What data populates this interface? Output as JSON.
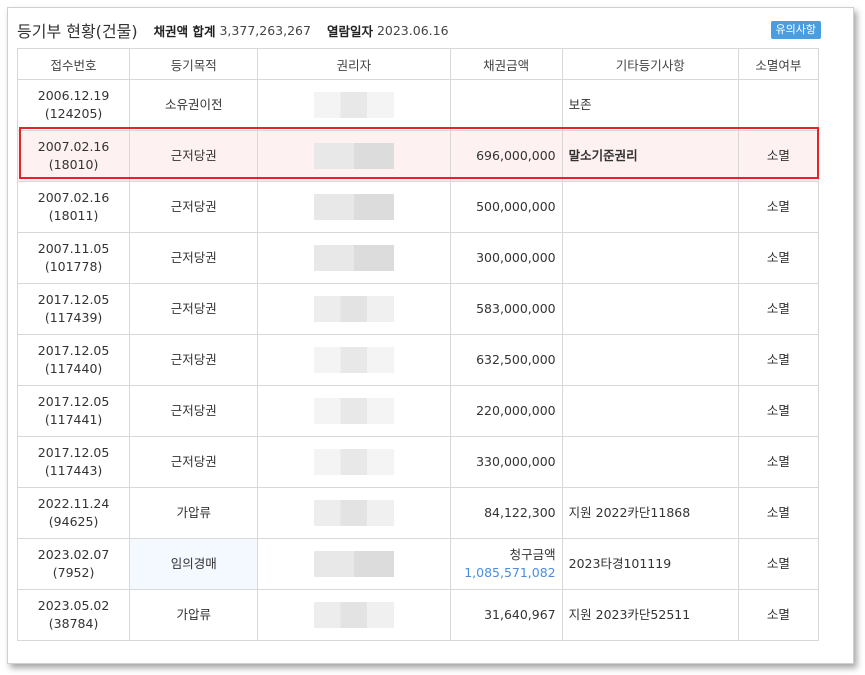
{
  "header": {
    "title": "등기부 현황(건물)",
    "claim_total_label": "채권액 합계",
    "claim_total_value": "3,377,263,267",
    "view_date_label": "열람일자",
    "view_date_value": "2023.06.16",
    "notice_button": "유의사항"
  },
  "table": {
    "columns": [
      "접수번호",
      "등기목적",
      "권리자",
      "채권금액",
      "기타등기사항",
      "소멸여부"
    ],
    "rows": [
      {
        "date": "2006.12.19",
        "num": "(124205)",
        "purpose": "소유권이전",
        "amount": "",
        "claim_label": "",
        "note": "보존",
        "status": ""
      },
      {
        "date": "2007.02.16",
        "num": "(18010)",
        "purpose": "근저당권",
        "amount": "696,000,000",
        "claim_label": "",
        "note": "말소기준권리",
        "status": "소멸",
        "highlight": true
      },
      {
        "date": "2007.02.16",
        "num": "(18011)",
        "purpose": "근저당권",
        "amount": "500,000,000",
        "claim_label": "",
        "note": "",
        "status": "소멸"
      },
      {
        "date": "2007.11.05",
        "num": "(101778)",
        "purpose": "근저당권",
        "amount": "300,000,000",
        "claim_label": "",
        "note": "",
        "status": "소멸"
      },
      {
        "date": "2017.12.05",
        "num": "(117439)",
        "purpose": "근저당권",
        "amount": "583,000,000",
        "claim_label": "",
        "note": "",
        "status": "소멸"
      },
      {
        "date": "2017.12.05",
        "num": "(117440)",
        "purpose": "근저당권",
        "amount": "632,500,000",
        "claim_label": "",
        "note": "",
        "status": "소멸"
      },
      {
        "date": "2017.12.05",
        "num": "(117441)",
        "purpose": "근저당권",
        "amount": "220,000,000",
        "claim_label": "",
        "note": "",
        "status": "소멸"
      },
      {
        "date": "2017.12.05",
        "num": "(117443)",
        "purpose": "근저당권",
        "amount": "330,000,000",
        "claim_label": "",
        "note": "",
        "status": "소멸"
      },
      {
        "date": "2022.11.24",
        "num": "(94625)",
        "purpose": "가압류",
        "amount": "84,122,300",
        "claim_label": "",
        "note": "지원 2022카단11868",
        "status": "소멸"
      },
      {
        "date": "2023.02.07",
        "num": "(7952)",
        "purpose": "임의경매",
        "amount": "1,085,571,082",
        "claim_label": "청구금액",
        "note": "2023타경101119",
        "status": "소멸"
      },
      {
        "date": "2023.05.02",
        "num": "(38784)",
        "purpose": "가압류",
        "amount": "31,640,967",
        "claim_label": "",
        "note": "지원 2023카단52511",
        "status": "소멸"
      }
    ]
  },
  "colors": {
    "highlight_border": "#e5232b",
    "highlight_bg": "#fdf1f1",
    "notice_bg": "#4a9de0",
    "claim_value": "#4a8ee0"
  }
}
